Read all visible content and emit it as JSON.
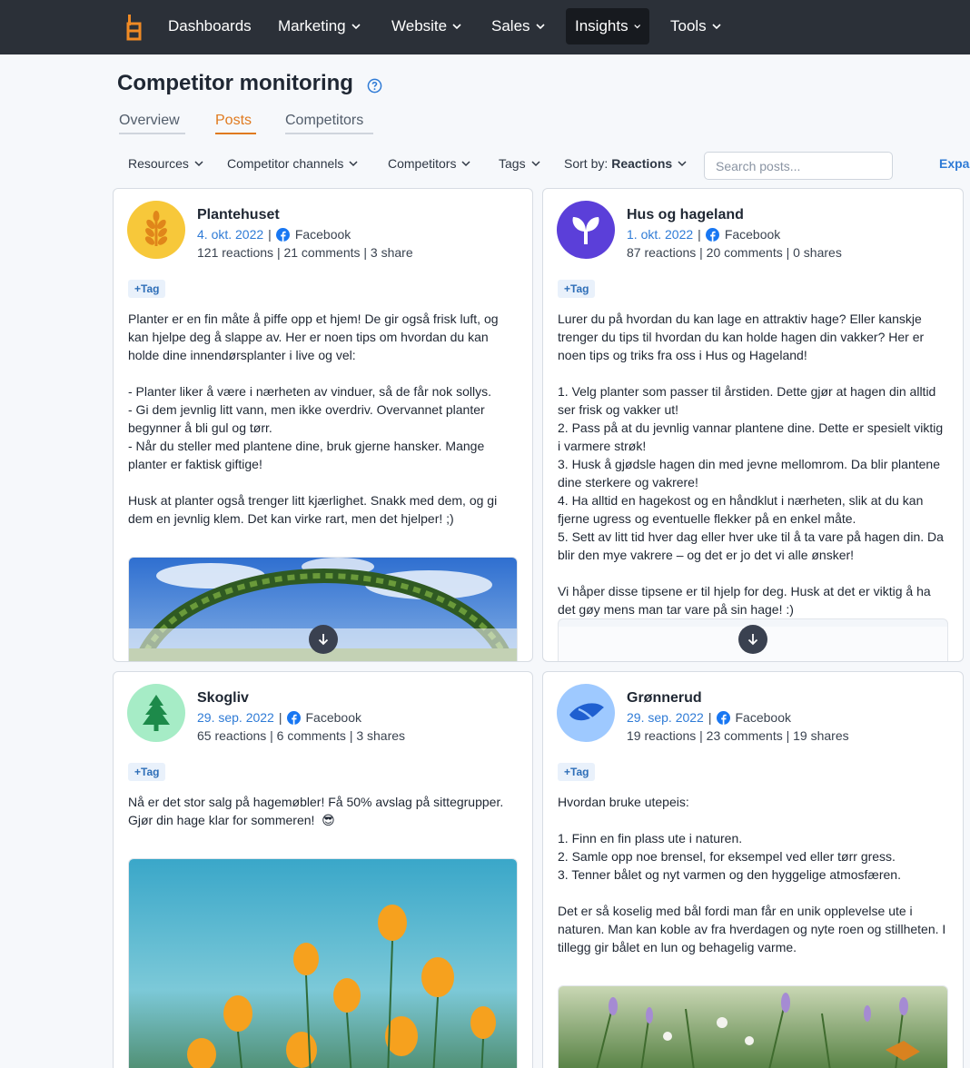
{
  "nav": {
    "items": [
      {
        "label": "Dashboards",
        "has_menu": false
      },
      {
        "label": "Marketing",
        "has_menu": true
      },
      {
        "label": "Website",
        "has_menu": true
      },
      {
        "label": "Sales",
        "has_menu": true
      },
      {
        "label": "Insights",
        "has_menu": true,
        "active": true
      },
      {
        "label": "Tools",
        "has_menu": true
      }
    ]
  },
  "header": {
    "title": "Competitor monitoring",
    "help_icon": "question-circle-icon"
  },
  "tabs": [
    {
      "label": "Overview",
      "active": false
    },
    {
      "label": "Posts",
      "active": true
    },
    {
      "label": "Competitors",
      "active": false
    }
  ],
  "filters": {
    "resources": "Resources",
    "channels": "Competitor channels",
    "competitors": "Competitors",
    "tags": "Tags",
    "sort_prefix": "Sort by:",
    "sort_value": "Reactions",
    "search_placeholder": "Search posts...",
    "expand": "Expa"
  },
  "colors": {
    "nav_bg": "#2b3038",
    "accent": "#e07a1f",
    "link": "#2f7bd6"
  },
  "posts": [
    {
      "name": "Plantehuset",
      "date": "4. okt. 2022",
      "channel": "Facebook",
      "stats": "121 reactions | 21 comments | 3 share",
      "tag_label": "+Tag",
      "avatar_icon": "wheat-icon",
      "text": "Planter er en fin måte å piffe opp et hjem! De gir også frisk luft, og kan hjelpe deg å slappe av. Her er noen tips om hvordan du kan holde dine innendørsplanter i live og vel:\n\n- Planter liker å være i nærheten av vinduer, så de får nok sollys.\n- Gi dem jevnlig litt vann, men ikke overdriv. Overvannet planter begynner å bli gul og tørr.\n- Når du steller med plantene dine, bruk gjerne hansker. Mange planter er faktisk giftige!\n\nHusk at planter også trenger litt kjærlighet. Snakk med dem, og gi dem en jevnlig klem. Det kan virke rart, men det hjelper! ;)"
    },
    {
      "name": "Hus og hageland",
      "date": "1. okt. 2022",
      "channel": "Facebook",
      "stats": "87 reactions | 20 comments | 0 shares",
      "tag_label": "+Tag",
      "avatar_icon": "sprout-icon",
      "text": "Lurer du på hvordan du kan lage en attraktiv hage? Eller kanskje trenger du tips til hvordan du kan holde hagen din vakker? Her er noen tips og triks fra oss i Hus og Hageland!\n\n1. Velg planter som passer til årstiden. Dette gjør at hagen din alltid ser frisk og vakker ut!\n2. Pass på at du jevnlig vannar plantene dine. Dette er spesielt viktig i varmere strøk!\n3. Husk å gjødsle hagen din med jevne mellomrom. Da blir plantene dine sterkere og vakrere!\n4. Ha alltid en hagekost og en håndklut i nærheten, slik at du kan fjerne ugress og eventuelle flekker på en enkel måte.\n5. Sett av litt tid hver dag eller hver uke til å ta vare på hagen din. Da blir den mye vakrere – og det er jo det vi alle ønsker!\n\nVi håper disse tipsene er til hjelp for deg. Husk at det er viktig å ha det gøy mens man tar vare på sin hage! :)"
    },
    {
      "name": "Skogliv",
      "date": "29. sep. 2022",
      "channel": "Facebook",
      "stats": "65 reactions | 6 comments | 3 shares",
      "tag_label": "+Tag",
      "avatar_icon": "pine-tree-icon",
      "text": "Nå er det stor salg på hagemøbler! Få 50% avslag på sittegrupper. Gjør din hage klar for sommeren!  😎"
    },
    {
      "name": "Grønnerud",
      "date": "29. sep. 2022",
      "channel": "Facebook",
      "stats": "19 reactions | 23 comments | 19 shares",
      "tag_label": "+Tag",
      "avatar_icon": "leaf-icon",
      "text": "Hvordan bruke utepeis:\n\n1. Finn en fin plass ute i naturen.\n2. Samle opp noe brensel, for eksempel ved eller tørr gress.\n3. Tenner bålet og nyt varmen og den hyggelige atmosfæren.\n\nDet er så koselig med bål fordi man får en unik opplevelse ute i naturen. Man kan koble av fra hverdagen og nyte roen og stillheten. I tillegg gir bålet en lun og behagelig varme."
    }
  ]
}
